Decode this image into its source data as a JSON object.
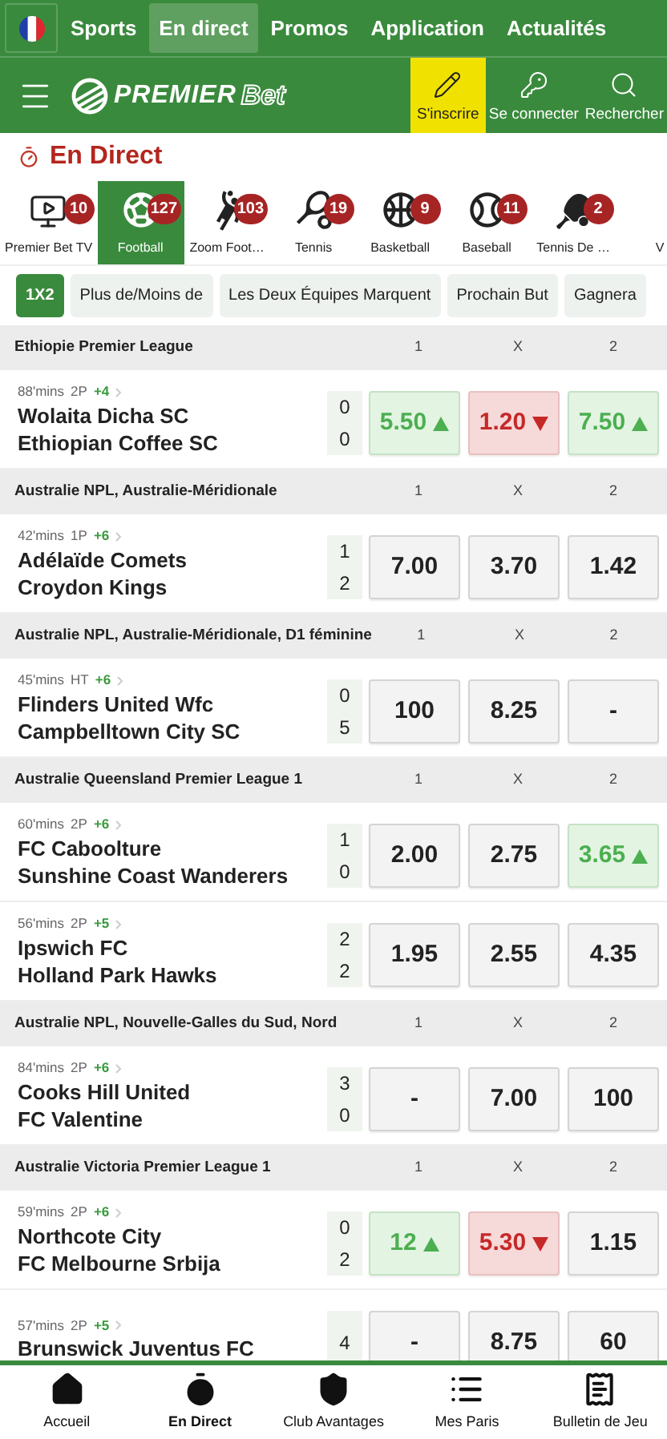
{
  "top_nav": {
    "tabs": [
      {
        "label": "Sports",
        "selected": false
      },
      {
        "label": "En direct",
        "selected": true
      },
      {
        "label": "Promos",
        "selected": false
      },
      {
        "label": "Application",
        "selected": false
      },
      {
        "label": "Actualités",
        "selected": false
      }
    ]
  },
  "header": {
    "logo": {
      "part_1": "PREMIER",
      "part_2": "Bet"
    },
    "actions": [
      {
        "kind": "signup",
        "label": "S'inscrire",
        "highlighted": true
      },
      {
        "kind": "login",
        "label": "Se connecter",
        "highlighted": false
      },
      {
        "kind": "search",
        "label": "Rechercher",
        "highlighted": false
      }
    ]
  },
  "page_title": "En Direct",
  "sports": [
    {
      "kind": "tv",
      "label": "Premier Bet TV",
      "count": "10",
      "selected": false
    },
    {
      "kind": "football",
      "label": "Football",
      "count": "127",
      "selected": true
    },
    {
      "kind": "zoom",
      "label": "Zoom Foot…",
      "count": "103",
      "selected": false
    },
    {
      "kind": "tennis",
      "label": "Tennis",
      "count": "19",
      "selected": false
    },
    {
      "kind": "basketball",
      "label": "Basketball",
      "count": "9",
      "selected": false
    },
    {
      "kind": "baseball",
      "label": "Baseball",
      "count": "11",
      "selected": false
    },
    {
      "kind": "tabletennis",
      "label": "Tennis De …",
      "count": "2",
      "selected": false
    },
    {
      "kind": "other",
      "label": "V",
      "selected": false
    }
  ],
  "markets": [
    {
      "label": "1X2",
      "selected": true
    },
    {
      "label": "Plus de/Moins de",
      "selected": false
    },
    {
      "label": "Les Deux Équipes Marquent",
      "selected": false
    },
    {
      "label": "Prochain But",
      "selected": false
    },
    {
      "label": "Gagnera",
      "selected": false
    }
  ],
  "leagues": [
    {
      "name": "Ethiopie Premier League",
      "col_1": "1",
      "col_2": "X",
      "col_3": "2",
      "matches": [
        {
          "time": "88'mins",
          "period": "2P",
          "more": "+4",
          "teams": [
            "Wolaita Dicha SC",
            "Ethiopian Coffee SC"
          ],
          "scores": [
            "0",
            "0"
          ],
          "odds": [
            {
              "value": "5.50",
              "rising": true,
              "falling": false
            },
            {
              "value": "1.20",
              "rising": false,
              "falling": true
            },
            {
              "value": "7.50",
              "rising": true,
              "falling": false
            }
          ]
        }
      ]
    },
    {
      "name": "Australie NPL, Australie-Méridionale",
      "col_1": "1",
      "col_2": "X",
      "col_3": "2",
      "matches": [
        {
          "time": "42'mins",
          "period": "1P",
          "more": "+6",
          "teams": [
            "Adélaïde Comets",
            "Croydon Kings"
          ],
          "scores": [
            "1",
            "2"
          ],
          "odds": [
            {
              "value": "7.00",
              "rising": false,
              "falling": false
            },
            {
              "value": "3.70",
              "rising": false,
              "falling": false
            },
            {
              "value": "1.42",
              "rising": false,
              "falling": false
            }
          ]
        }
      ]
    },
    {
      "name": "Australie NPL, Australie-Méridionale, D1 féminine",
      "col_1": "1",
      "col_2": "X",
      "col_3": "2",
      "matches": [
        {
          "time": "45'mins",
          "period": "HT",
          "more": "+6",
          "teams": [
            "Flinders United Wfc",
            "Campbelltown City SC"
          ],
          "scores": [
            "0",
            "5"
          ],
          "odds": [
            {
              "value": "100",
              "rising": false,
              "falling": false
            },
            {
              "value": "8.25",
              "rising": false,
              "falling": false
            },
            {
              "value": "-",
              "rising": false,
              "falling": false
            }
          ]
        }
      ]
    },
    {
      "name": "Australie Queensland Premier League 1",
      "col_1": "1",
      "col_2": "X",
      "col_3": "2",
      "matches": [
        {
          "time": "60'mins",
          "period": "2P",
          "more": "+6",
          "teams": [
            "FC Caboolture",
            "Sunshine Coast Wanderers"
          ],
          "scores": [
            "1",
            "0"
          ],
          "odds": [
            {
              "value": "2.00",
              "rising": false,
              "falling": false
            },
            {
              "value": "2.75",
              "rising": false,
              "falling": false
            },
            {
              "value": "3.65",
              "rising": true,
              "falling": false
            }
          ]
        },
        {
          "time": "56'mins",
          "period": "2P",
          "more": "+5",
          "teams": [
            "Ipswich FC",
            "Holland Park Hawks"
          ],
          "scores": [
            "2",
            "2"
          ],
          "odds": [
            {
              "value": "1.95",
              "rising": false,
              "falling": false
            },
            {
              "value": "2.55",
              "rising": false,
              "falling": false
            },
            {
              "value": "4.35",
              "rising": false,
              "falling": false
            }
          ]
        }
      ]
    },
    {
      "name": "Australie NPL, Nouvelle-Galles du Sud, Nord",
      "col_1": "1",
      "col_2": "X",
      "col_3": "2",
      "matches": [
        {
          "time": "84'mins",
          "period": "2P",
          "more": "+6",
          "teams": [
            "Cooks Hill United",
            "FC Valentine"
          ],
          "scores": [
            "3",
            "0"
          ],
          "odds": [
            {
              "value": "-",
              "rising": false,
              "falling": false
            },
            {
              "value": "7.00",
              "rising": false,
              "falling": false
            },
            {
              "value": "100",
              "rising": false,
              "falling": false
            }
          ]
        }
      ]
    },
    {
      "name": "Australie Victoria Premier League 1",
      "col_1": "1",
      "col_2": "X",
      "col_3": "2",
      "matches": [
        {
          "time": "59'mins",
          "period": "2P",
          "more": "+6",
          "teams": [
            "Northcote City",
            "FC Melbourne Srbija"
          ],
          "scores": [
            "0",
            "2"
          ],
          "odds": [
            {
              "value": "12",
              "rising": true,
              "falling": false
            },
            {
              "value": "5.30",
              "rising": false,
              "falling": true
            },
            {
              "value": "1.15",
              "rising": false,
              "falling": false
            }
          ]
        },
        {
          "time": "57'mins",
          "period": "2P",
          "more": "+5",
          "teams": [
            "Brunswick Juventus FC"
          ],
          "scores": [
            "4"
          ],
          "odds": [
            {
              "value": "-",
              "rising": false,
              "falling": false
            },
            {
              "value": "8.75",
              "rising": false,
              "falling": false
            },
            {
              "value": "60",
              "rising": false,
              "falling": false
            }
          ]
        }
      ]
    }
  ],
  "bottom_nav": [
    {
      "kind": "home",
      "label": "Accueil",
      "selected": false
    },
    {
      "kind": "live",
      "label": "En Direct",
      "selected": true
    },
    {
      "kind": "club",
      "label": "Club Avantages",
      "selected": false
    },
    {
      "kind": "bets",
      "label": "Mes Paris",
      "selected": false
    },
    {
      "kind": "slip",
      "label": "Bulletin de Jeu",
      "selected": false
    }
  ]
}
